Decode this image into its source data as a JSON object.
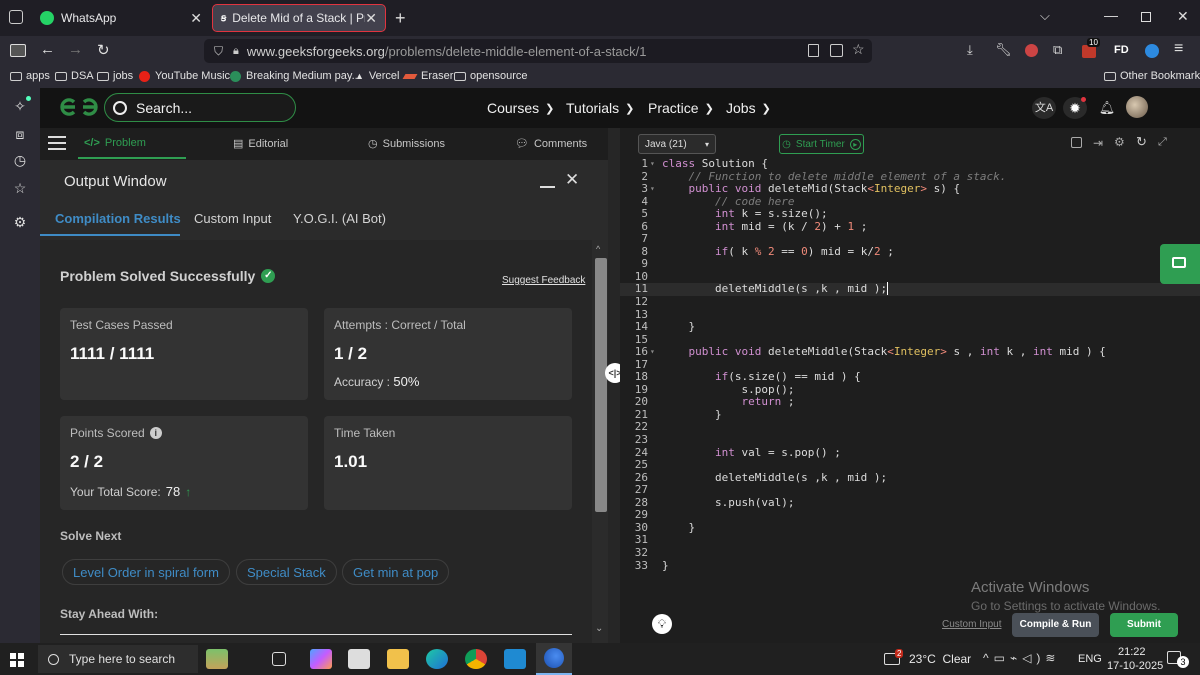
{
  "browser": {
    "tabs": [
      {
        "title": "WhatsApp",
        "active": false
      },
      {
        "title": "Delete Mid of a Stack | Practice",
        "active": true
      }
    ],
    "url_prefix": "www.geeksforgeeks.org",
    "url_path": "/problems/delete-middle-element-of-a-stack/1",
    "badge_count": "10",
    "profile_label": "FD",
    "bookmarks": [
      "apps",
      "DSA",
      "jobs",
      "YouTube Music",
      "Breaking Medium pay...",
      "Vercel",
      "Eraser",
      "opensource"
    ],
    "other_bookmarks": "Other Bookmarks"
  },
  "site": {
    "logo": "GfG",
    "search_placeholder": "Search...",
    "menus": [
      "Courses",
      "Tutorials",
      "Practice",
      "Jobs"
    ]
  },
  "problem_tabs": [
    {
      "label": "Problem",
      "icon": "</>",
      "active": true
    },
    {
      "label": "Editorial",
      "active": false
    },
    {
      "label": "Submissions",
      "active": false
    },
    {
      "label": "Comments",
      "active": false
    }
  ],
  "output": {
    "title": "Output Window",
    "tabs": [
      "Compilation Results",
      "Custom Input",
      "Y.O.G.I. (AI Bot)"
    ],
    "status": "Problem Solved Successfully",
    "feedback": "Suggest Feedback",
    "cards": {
      "test_cases": {
        "label": "Test Cases Passed",
        "value": "1111 / 1111"
      },
      "attempts": {
        "label": "Attempts : Correct / Total",
        "value": "1 / 2",
        "sub_label": "Accuracy :",
        "sub_value": "50%"
      },
      "points": {
        "label": "Points Scored",
        "value": "2 / 2",
        "sub_label": "Your Total Score:",
        "sub_value": "78"
      },
      "time": {
        "label": "Time Taken",
        "value": "1.01"
      }
    },
    "solve_next_label": "Solve Next",
    "solve_next": [
      "Level Order in spiral form",
      "Special Stack",
      "Get min at pop"
    ],
    "stay_ahead": "Stay Ahead With:"
  },
  "editor": {
    "language": "Java (21)",
    "start_timer": "Start Timer",
    "code_lines": [
      "class Solution {",
      "    // Function to delete middle element of a stack.",
      "    public void deleteMid(Stack<Integer> s) {",
      "        // code here",
      "        int k = s.size();",
      "        int mid = (k / 2) + 1 ;",
      "",
      "        if( k % 2 == 0) mid = k/2 ;",
      "",
      "",
      "        deleteMiddle(s ,k , mid );",
      "",
      "",
      "    }",
      "",
      "    public void deleteMiddle(Stack<Integer> s , int k , int mid ) {",
      "",
      "        if(s.size() == mid ) {",
      "            s.pop();",
      "            return ;",
      "        }",
      "",
      "",
      "        int val = s.pop() ;",
      "",
      "        deleteMiddle(s ,k , mid );",
      "",
      "        s.push(val);",
      "",
      "    }",
      "",
      "",
      "}"
    ],
    "fold_lines": [
      1,
      3,
      16
    ],
    "active_line": 11,
    "custom_input": "Custom Input",
    "compile_run": "Compile & Run",
    "submit": "Submit",
    "activate_title": "Activate Windows",
    "activate_sub": "Go to Settings to activate Windows."
  },
  "taskbar": {
    "search_placeholder": "Type here to search",
    "weather": "23°C  Clear",
    "weather_badge": "2",
    "language": "ENG",
    "time": "21:22",
    "date": "17-10-2025",
    "notification_count": "3"
  },
  "colors": {
    "gfg_green": "#2f8d46",
    "accent_green": "#2f9e52",
    "link_blue": "#3f8cc6",
    "tab_active_border": "#e0343f"
  }
}
